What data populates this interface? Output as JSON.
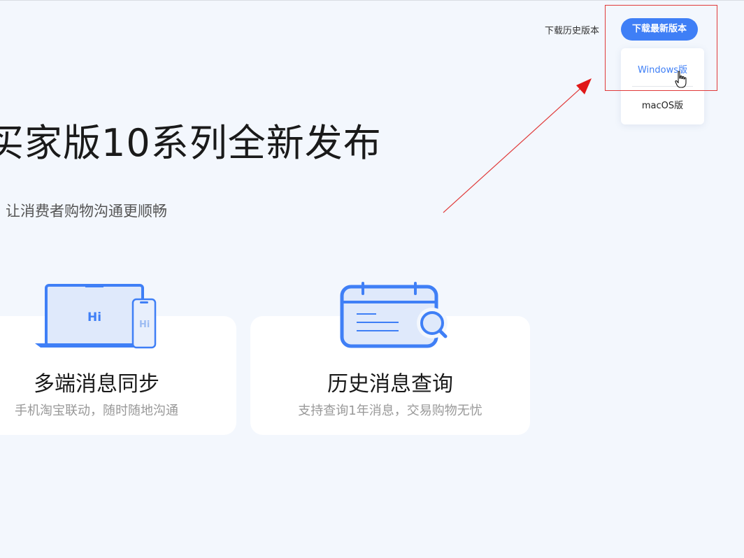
{
  "header": {
    "history_link": "下载历史版本",
    "download_button": "下载最新版本",
    "dropdown": {
      "windows": "Windows版",
      "mac": "macOS版"
    }
  },
  "hero": {
    "title": "买家版10系列全新发布",
    "subtitle": "让消费者购物沟通更顺畅"
  },
  "cards": [
    {
      "title": "多端消息同步",
      "description": "手机淘宝联动，随时随地沟通",
      "illustration_text_laptop": "Hi",
      "illustration_text_phone": "Hi"
    },
    {
      "title": "历史消息查询",
      "description": "支持查询1年消息，交易购物无忧"
    }
  ],
  "colors": {
    "accent": "#3f7ff6",
    "background": "#f3f7fd",
    "annotation": "#e03a3a"
  },
  "icons": [
    "laptop-phone-icon",
    "calendar-search-icon",
    "hand-cursor-icon"
  ]
}
